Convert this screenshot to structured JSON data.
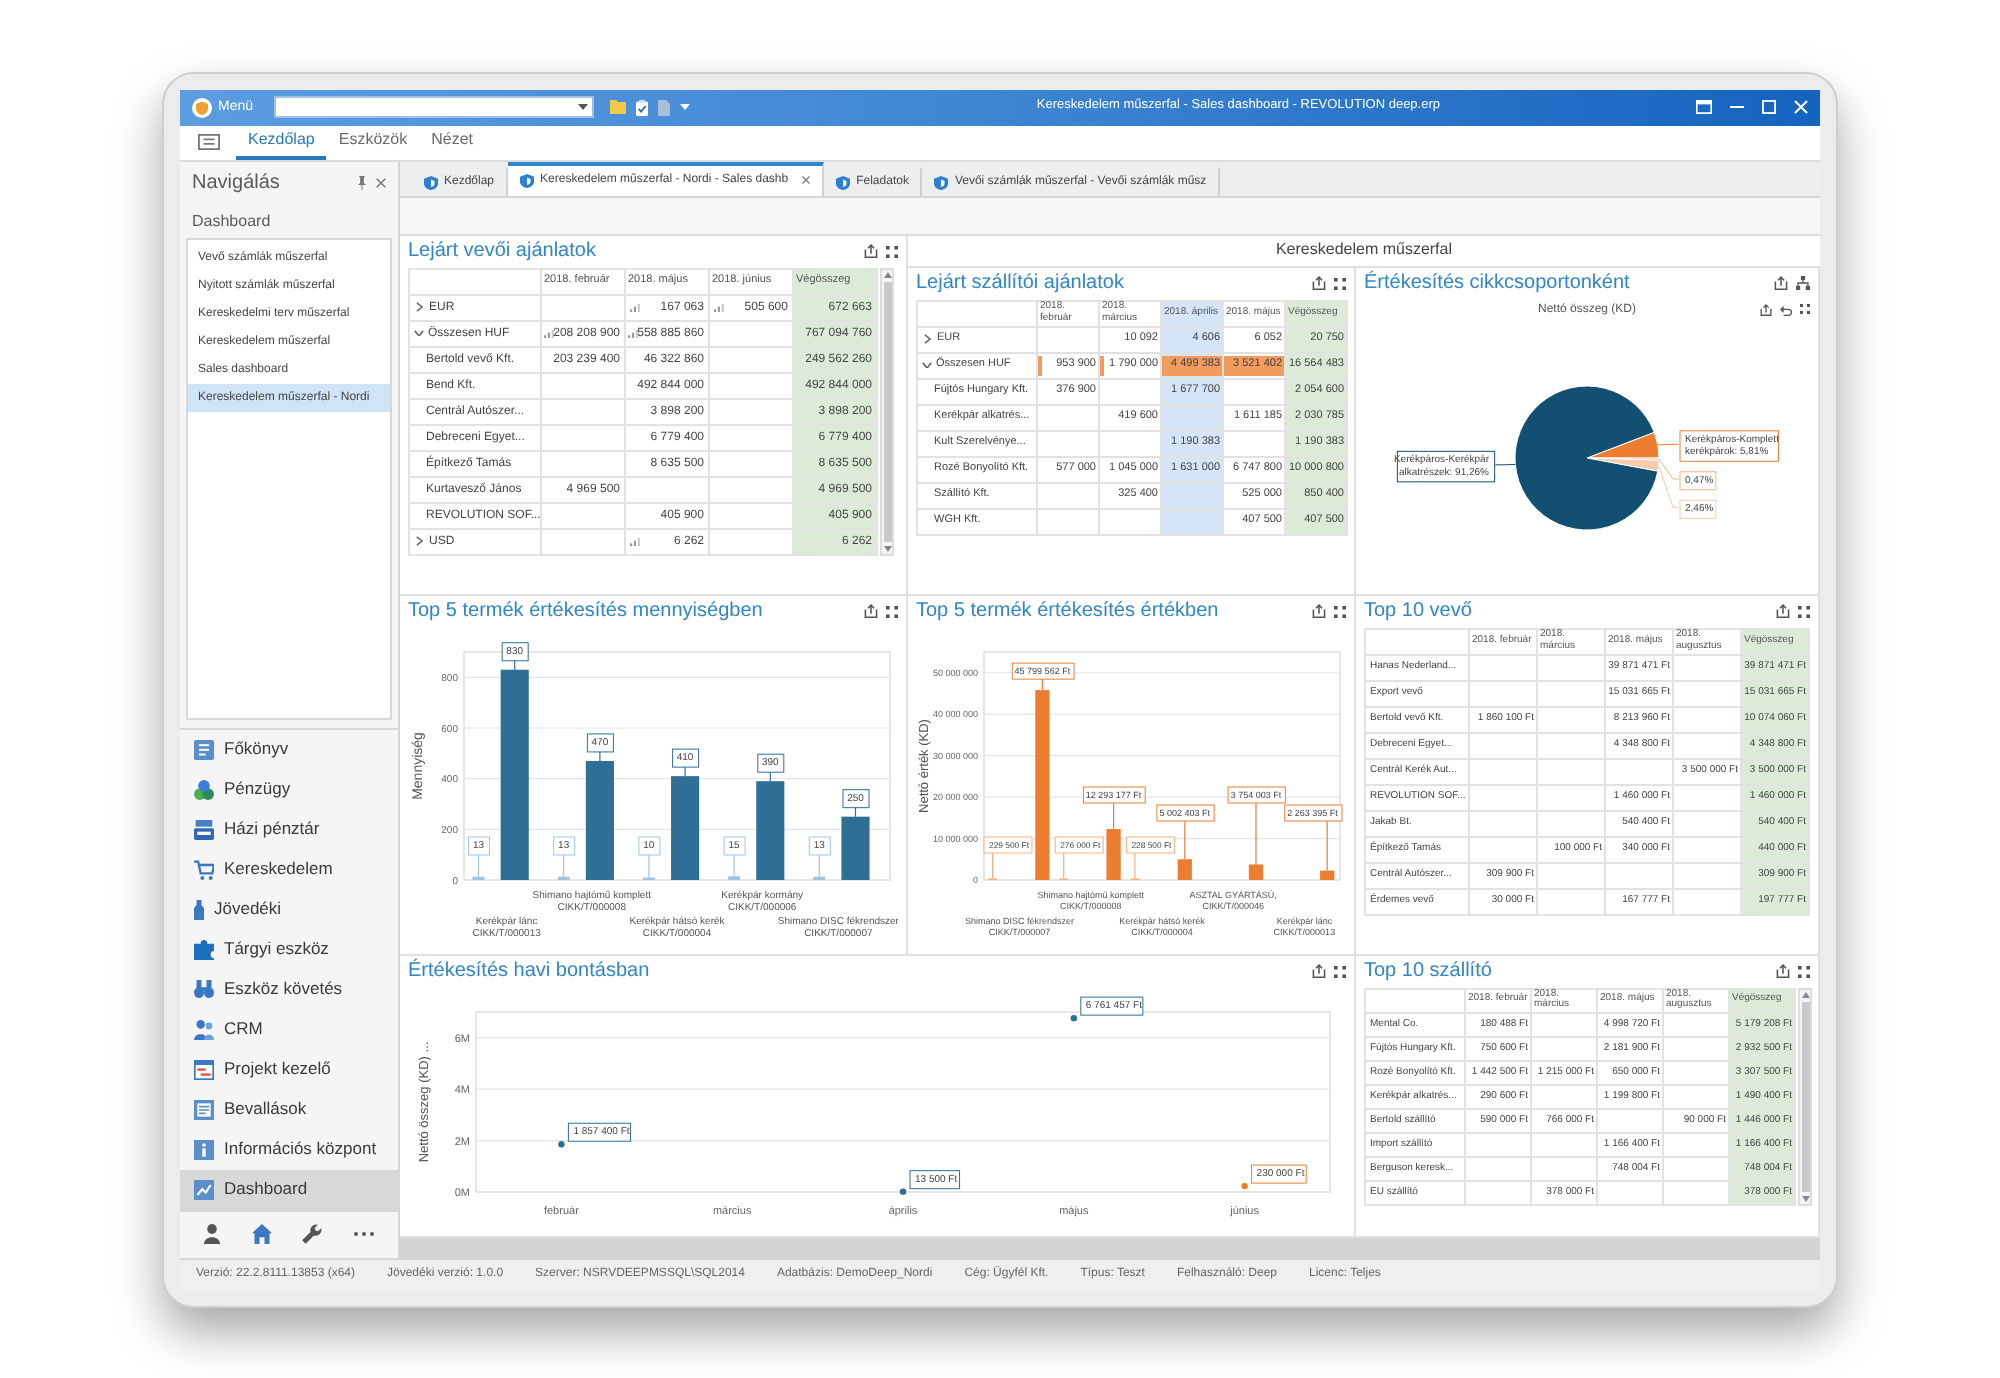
{
  "title_bar": {
    "menu": "Menü",
    "title": "Kereskedelem műszerfal - Sales dashboard - REVOLUTION deep.erp"
  },
  "ribbon_tabs": [
    {
      "label": "Kezdőlap",
      "selected": true
    },
    {
      "label": "Eszközök",
      "selected": false
    },
    {
      "label": "Nézet",
      "selected": false
    }
  ],
  "navigation": {
    "title": "Navigálás",
    "section": "Dashboard",
    "items": [
      {
        "label": "Vevő számlák műszerfal",
        "selected": false
      },
      {
        "label": "Nyitott számlák műszerfal",
        "selected": false
      },
      {
        "label": "Kereskedelmi terv műszerfal",
        "selected": false
      },
      {
        "label": "Kereskedelem műszerfal",
        "selected": false
      },
      {
        "label": "Sales dashboard",
        "selected": false
      },
      {
        "label": "Kereskedelem műszerfal - Nordi",
        "selected": true
      }
    ],
    "modules": [
      {
        "label": "Főkönyv",
        "selected": false
      },
      {
        "label": "Pénzügy",
        "selected": false
      },
      {
        "label": "Házi pénztár",
        "selected": false
      },
      {
        "label": "Kereskedelem",
        "selected": false
      },
      {
        "label": "Jövedéki",
        "selected": false
      },
      {
        "label": "Tárgyi eszköz",
        "selected": false
      },
      {
        "label": "Eszköz követés",
        "selected": false
      },
      {
        "label": "CRM",
        "selected": false
      },
      {
        "label": "Projekt kezelő",
        "selected": false
      },
      {
        "label": "Bevallások",
        "selected": false
      },
      {
        "label": "Információs központ",
        "selected": false
      },
      {
        "label": "Dashboard",
        "selected": true
      }
    ]
  },
  "document_tabs": [
    {
      "label": "Kezdőlap",
      "selected": false
    },
    {
      "label": "Kereskedelem műszerfal - Nordi - Sales dashb",
      "selected": true
    },
    {
      "label": "Feladatok",
      "selected": false
    },
    {
      "label": "Vevői számlák műszerfal - Vevői számlák műsz",
      "selected": false
    }
  ],
  "dashboard": {
    "title": "Kereskedelem műszerfal",
    "customer_offers": {
      "title": "Lejárt vevői ajánlatok",
      "indicator_icons": true,
      "columns": [
        {
          "label": "2018. február",
          "kind": "period"
        },
        {
          "label": "2018. május",
          "kind": "period"
        },
        {
          "label": "2018. június",
          "kind": "period"
        },
        {
          "label": "Végösszeg",
          "kind": "total"
        }
      ],
      "rows": [
        {
          "label": "EUR",
          "expanded": false,
          "cells": [
            null,
            "167 063",
            "505 600",
            "672 663"
          ]
        },
        {
          "label": "Összesen HUF",
          "expanded": true,
          "cells": [
            "208 208 900",
            "558 885 860",
            null,
            "767 094 760"
          ],
          "children": [
            {
              "label": "Bertold vevő Kft.",
              "cells": [
                "203 239 400",
                "46 322 860",
                null,
                "249 562 260"
              ]
            },
            {
              "label": "Bend Kft.",
              "cells": [
                null,
                "492 844 000",
                null,
                "492 844 000"
              ]
            },
            {
              "label": "Centrál Autószer...",
              "cells": [
                null,
                "3 898 200",
                null,
                "3 898 200"
              ]
            },
            {
              "label": "Debreceni Egyet...",
              "cells": [
                null,
                "6 779 400",
                null,
                "6 779 400"
              ]
            },
            {
              "label": "Építkező Tamás",
              "cells": [
                null,
                "8 635 500",
                null,
                "8 635 500"
              ]
            },
            {
              "label": "Kurtavesző János",
              "cells": [
                "4 969 500",
                null,
                null,
                "4 969 500"
              ]
            },
            {
              "label": "REVOLUTION SOF...",
              "cells": [
                null,
                "405 900",
                null,
                "405 900"
              ]
            }
          ]
        },
        {
          "label": "USD",
          "expanded": false,
          "cells": [
            null,
            "6 262",
            null,
            "6 262"
          ]
        }
      ]
    },
    "supplier_offers": {
      "title": "Lejárt szállítói ajánlatok",
      "columns": [
        {
          "label": "2018. február",
          "kind": "period",
          "selected": false
        },
        {
          "label": "2018. március",
          "kind": "period",
          "selected": false
        },
        {
          "label": "2018. április",
          "kind": "period",
          "selected": true
        },
        {
          "label": "2018. május",
          "kind": "period",
          "selected": false
        },
        {
          "label": "Végösszeg",
          "kind": "total",
          "selected": false
        }
      ],
      "rows": [
        {
          "label": "EUR",
          "expanded": false,
          "cells": [
            null,
            "10 092",
            "4 606",
            "6 052",
            "20 750"
          ]
        },
        {
          "label": "Összesen HUF",
          "expanded": true,
          "cells": [
            {
              "text": "953 900",
              "level": 0.08
            },
            {
              "text": "1 790 000",
              "level": 0.08
            },
            {
              "text": "4 499 383",
              "level": 1
            },
            {
              "text": "3 521 402",
              "level": 1
            },
            "16 564 483"
          ],
          "children": [
            {
              "label": "Fújtós Hungary Kft.",
              "cells": [
                "376 900",
                null,
                "1 677 700",
                null,
                "2 054 600"
              ]
            },
            {
              "label": "Kerékpár alkatrés...",
              "cells": [
                null,
                "419 600",
                null,
                "1 611 185",
                "2 030 785"
              ]
            },
            {
              "label": "Kult Szerelvénye...",
              "cells": [
                null,
                null,
                "1 190 383",
                null,
                "1 190 383"
              ]
            },
            {
              "label": "Rozé Bonyolító Kft.",
              "cells": [
                "577 000",
                "1 045 000",
                "1 631 000",
                "6 747 800",
                "10 000 800"
              ]
            },
            {
              "label": "Szállító Kft.",
              "cells": [
                null,
                "325 400",
                null,
                "525 000",
                "850 400"
              ]
            },
            {
              "label": "WGH Kft.",
              "cells": [
                null,
                null,
                null,
                "407 500",
                "407 500"
              ]
            }
          ]
        }
      ]
    },
    "sales_by_item_group": {
      "title": "Értékesítés cikkcsoportonként",
      "chart_data": {
        "type": "pie",
        "title": "Nettó összeg (KD)",
        "values": [
          5.81,
          0.47,
          2.46,
          91.26
        ],
        "colors": [
          "#ed7d31",
          "#f4b183",
          "#f8cbad",
          "#134f70"
        ],
        "value_labels": [
          "Kerékpáros-Komplett kerékpárok: 5,81%",
          "0,47%",
          "2,46%",
          "Kerékpáros-Kerékpár alkatrészek: 91,26%"
        ]
      }
    },
    "top5_by_quantity": {
      "title": "Top 5 termék értékesítés mennyiségben",
      "chart_data": {
        "type": "bar",
        "ylabel": "Mennyiség",
        "categories": [
          "Kerékpár lánc\nCIKK/T/000013",
          "Shimano hajtómű komplett\nCIKK/T/000008",
          "Kerékpár hátsó kerék\nCIKK/T/000004",
          "Kerékpár kormány\nCIKK/T/000006",
          "Shimano DISC fékrendszer\nCIKK/T/000007"
        ],
        "series": [
          {
            "color": "#9fc5e3",
            "values": [
              13,
              13,
              10,
              15,
              13
            ]
          },
          {
            "color": "#2f6f96",
            "values": [
              830,
              470,
              410,
              390,
              250
            ]
          }
        ],
        "ylim": [
          0,
          900
        ],
        "yticks": [
          0,
          200,
          400,
          600,
          800
        ],
        "grid": true,
        "data_labels": true
      }
    },
    "top5_by_value": {
      "title": "Top 5 termék értékesítés értékben",
      "chart_data": {
        "type": "bar",
        "ylabel": "Nettó érték (KD)",
        "categories": [
          "Shimano DISC fékrendszer\nCIKK/T/000007",
          "Shimano hajtómű komplett\nCIKK/T/000008",
          "Kerékpár hátsó kerék\nCIKK/T/000004",
          "ASZTAL GYÁRTÁSÚ,\nCIKK/T/000046",
          "Kerékpár lánc\nCIKK/T/000013"
        ],
        "series": [
          {
            "color": "#f4b183",
            "values": [
              229500,
              276000,
              228500,
              null,
              null
            ]
          },
          {
            "color": "#ed7d31",
            "values": [
              45799562,
              12293177,
              5002403,
              3754003,
              2263395
            ]
          }
        ],
        "ylim": [
          0,
          55000000
        ],
        "yticks": [
          {
            "value": 0,
            "label": "0"
          },
          {
            "value": 10000000,
            "label": "10 000 000"
          },
          {
            "value": 20000000,
            "label": "20 000 000"
          },
          {
            "value": 30000000,
            "label": "30 000 000"
          },
          {
            "value": 40000000,
            "label": "40 000 000"
          },
          {
            "value": 50000000,
            "label": "50 000 000"
          }
        ],
        "grid": true,
        "value_labels": [
          [
            "229 500 Ft",
            "276 000 Ft",
            "228 500 Ft",
            null,
            null
          ],
          [
            "45 799 562 Ft",
            "12 293 177 Ft",
            "5 002 403 Ft",
            "3 754 003 Ft",
            "2 263 395 Ft"
          ]
        ]
      }
    },
    "top10_customers": {
      "title": "Top 10 vevő",
      "columns": [
        {
          "label": "2018. február",
          "kind": "period"
        },
        {
          "label": "2018. március",
          "kind": "period"
        },
        {
          "label": "2018. május",
          "kind": "period"
        },
        {
          "label": "2018. augusztus",
          "kind": "period"
        },
        {
          "label": "Végösszeg",
          "kind": "total"
        }
      ],
      "rows": [
        {
          "label": "Hanas Nederland...",
          "cells": [
            null,
            null,
            "39 871 471 Ft",
            null,
            "39 871 471 Ft"
          ]
        },
        {
          "label": "Export vevő",
          "cells": [
            null,
            null,
            "15 031 665 Ft",
            null,
            "15 031 665 Ft"
          ]
        },
        {
          "label": "Bertold vevő Kft.",
          "cells": [
            "1 860 100 Ft",
            null,
            "8 213 960 Ft",
            null,
            "10 074 060 Ft"
          ]
        },
        {
          "label": "Debreceni Egyet...",
          "cells": [
            null,
            null,
            "4 348 800 Ft",
            null,
            "4 348 800 Ft"
          ]
        },
        {
          "label": "Centrál Kerék Aut...",
          "cells": [
            null,
            null,
            null,
            "3 500 000 Ft",
            "3 500 000 Ft"
          ]
        },
        {
          "label": "REVOLUTION SOF...",
          "cells": [
            null,
            null,
            "1 460 000 Ft",
            null,
            "1 460 000 Ft"
          ]
        },
        {
          "label": "Jakab Bt.",
          "cells": [
            null,
            null,
            "540 400 Ft",
            null,
            "540 400 Ft"
          ]
        },
        {
          "label": "Építkező Tamás",
          "cells": [
            null,
            "100 000 Ft",
            "340 000 Ft",
            null,
            "440 000 Ft"
          ]
        },
        {
          "label": "Centrál Autószer...",
          "cells": [
            "309 900 Ft",
            null,
            null,
            null,
            "309 900 Ft"
          ]
        },
        {
          "label": "Érdemes vevő",
          "cells": [
            "30 000 Ft",
            null,
            "167 777 Ft",
            null,
            "197 777 Ft"
          ]
        }
      ]
    },
    "monthly_sales": {
      "title": "Értékesítés havi bontásban",
      "chart_data": {
        "type": "scatter",
        "ylabel": "Nettó összeg (KD) ...",
        "x": [
          "február",
          "március",
          "április",
          "május",
          "június"
        ],
        "series": [
          {
            "color": "#2f6f96",
            "values": [
              1857400,
              null,
              13500,
              6761457,
              null
            ]
          },
          {
            "color": "#ed7d31",
            "values": [
              null,
              null,
              null,
              null,
              230000
            ]
          }
        ],
        "ylim": [
          0,
          7000000
        ],
        "yticks": [
          {
            "value": 0,
            "label": "0M"
          },
          {
            "value": 2000000,
            "label": "2M"
          },
          {
            "value": 4000000,
            "label": "4M"
          },
          {
            "value": 6000000,
            "label": "6M"
          }
        ],
        "grid": true,
        "value_labels": [
          [
            "1 857 400 Ft",
            null,
            "13 500 Ft",
            "6 761 457 Ft",
            null
          ],
          [
            null,
            null,
            null,
            null,
            "230 000 Ft"
          ]
        ]
      }
    },
    "top10_suppliers": {
      "title": "Top 10 szállító",
      "columns": [
        {
          "label": "2018. február",
          "kind": "period"
        },
        {
          "label": "2018. március",
          "kind": "period"
        },
        {
          "label": "2018. május",
          "kind": "period"
        },
        {
          "label": "2018. augusztus",
          "kind": "period"
        },
        {
          "label": "Végösszeg",
          "kind": "total"
        }
      ],
      "rows": [
        {
          "label": "Mental Co.",
          "cells": [
            "180 488 Ft",
            null,
            "4 998 720 Ft",
            null,
            "5 179 208 Ft"
          ]
        },
        {
          "label": "Fújtós Hungary Kft.",
          "cells": [
            "750 600 Ft",
            null,
            "2 181 900 Ft",
            null,
            "2 932 500 Ft"
          ]
        },
        {
          "label": "Rozé Bonyolító Kft.",
          "cells": [
            "1 442 500 Ft",
            "1 215 000 Ft",
            "650 000 Ft",
            null,
            "3 307 500 Ft"
          ]
        },
        {
          "label": "Kerékpár alkatrés...",
          "cells": [
            "290 600 Ft",
            null,
            "1 199 800 Ft",
            null,
            "1 490 400 Ft"
          ]
        },
        {
          "label": "Bertold szállító",
          "cells": [
            "590 000 Ft",
            "766 000 Ft",
            null,
            "90 000 Ft",
            "1 446 000 Ft"
          ]
        },
        {
          "label": "Import szállító",
          "cells": [
            null,
            null,
            "1 166 400 Ft",
            null,
            "1 166 400 Ft"
          ]
        },
        {
          "label": "Berguson keresk...",
          "cells": [
            null,
            null,
            "748 004 Ft",
            null,
            "748 004 Ft"
          ]
        },
        {
          "label": "EU szállító",
          "cells": [
            null,
            "378 000 Ft",
            null,
            null,
            "378 000 Ft"
          ]
        }
      ]
    }
  },
  "status_bar": [
    "Verzió: 22.2.8111.13853 (x64)",
    "Jövedéki verzió: 1.0.0",
    "Szerver: NSRVDEEPMSSQL\\SQL2014",
    "Adatbázis: DemoDeep_Nordi",
    "Cég: Ügyfél Kft.",
    "Típus: Teszt",
    "Felhasználó: Deep",
    "Licenc: Teljes"
  ]
}
